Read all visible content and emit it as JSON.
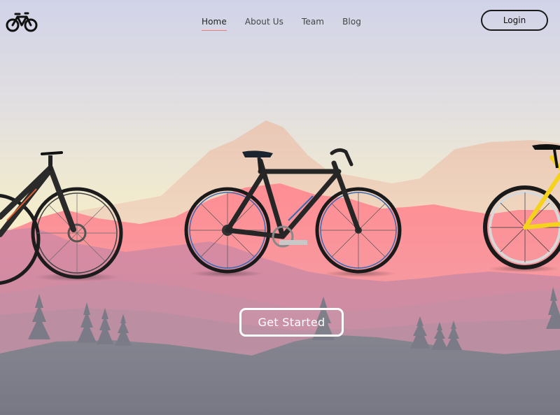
{
  "header": {
    "logo_icon": "bicycle-icon",
    "nav": [
      {
        "label": "Home",
        "active": true
      },
      {
        "label": "About Us",
        "active": false
      },
      {
        "label": "Team",
        "active": false
      },
      {
        "label": "Blog",
        "active": false
      }
    ],
    "login_label": "Login"
  },
  "hero": {
    "cta_label": "Get Started",
    "bikes": [
      "mountain-bike",
      "city-bike",
      "yellow-road-bike"
    ]
  },
  "colors": {
    "sky_top": "#d3d4e6",
    "sky_horizon": "#f5efc8",
    "mountain_far": "#e9c3b4",
    "mountain_pink": "#ff8f96",
    "mountain_mauve": "#d98ba0",
    "forest": "#7d7d88",
    "accent_underline": "#f07a7a"
  }
}
